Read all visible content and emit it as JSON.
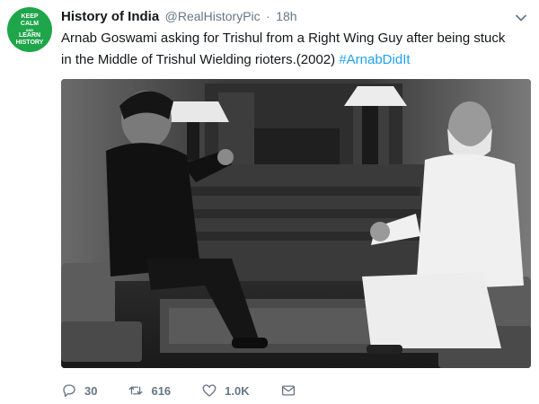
{
  "tweet": {
    "avatar_text": [
      "KEEP",
      "CALM",
      "AND",
      "LEARN",
      "HISTORY"
    ],
    "display_name": "History of India",
    "handle": "@RealHistoryPic",
    "separator": "·",
    "time": "18h",
    "text": "Arnab Goswami asking for Trishul from a Right Wing Guy after being stuck in the Middle of Trishul Wielding rioters.(2002) ",
    "hashtag": "#ArnabDidIt",
    "actions": {
      "reply_count": "30",
      "retweet_count": "616",
      "like_count": "1.0K"
    },
    "icons": {
      "more": "chevron-down-icon",
      "reply": "reply-icon",
      "retweet": "retweet-icon",
      "like": "heart-icon",
      "dm": "envelope-icon"
    }
  },
  "colors": {
    "avatar_bg": "#1fa54a",
    "name": "#14171a",
    "secondary": "#657786",
    "link": "#1da1f2"
  }
}
